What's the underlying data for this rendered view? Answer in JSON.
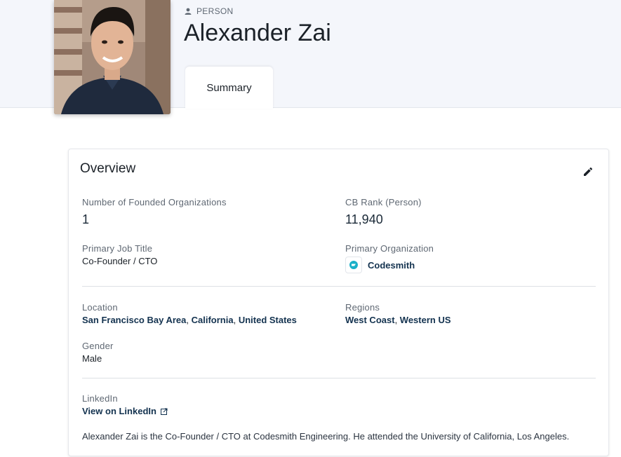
{
  "header": {
    "entity_type": "PERSON",
    "name": "Alexander Zai",
    "tabs": [
      {
        "label": "Summary",
        "active": true
      }
    ]
  },
  "overview": {
    "title": "Overview",
    "founded_orgs": {
      "label": "Number of Founded Organizations",
      "value": "1"
    },
    "cb_rank": {
      "label": "CB Rank (Person)",
      "value": "11,940"
    },
    "job_title": {
      "label": "Primary Job Title",
      "value": "Co-Founder / CTO"
    },
    "primary_org": {
      "label": "Primary Organization",
      "value": "Codesmith"
    },
    "location": {
      "label": "Location",
      "parts": [
        "San Francisco Bay Area",
        "California",
        "United States"
      ]
    },
    "regions": {
      "label": "Regions",
      "parts": [
        "West Coast",
        "Western US"
      ]
    },
    "gender": {
      "label": "Gender",
      "value": "Male"
    },
    "linkedin": {
      "label": "LinkedIn",
      "link_text": "View on LinkedIn"
    },
    "description": "Alexander Zai is the Co-Founder / CTO at Codesmith Engineering. He attended the University of California, Los Angeles."
  },
  "colors": {
    "link": "#13324f",
    "accent": "#1ab0c8",
    "header_bg": "#f4f6fb"
  },
  "icons": {
    "entity_type": "person-icon",
    "edit": "pencil-icon",
    "external": "external-link-icon",
    "org_logo": "codesmith-logo"
  }
}
